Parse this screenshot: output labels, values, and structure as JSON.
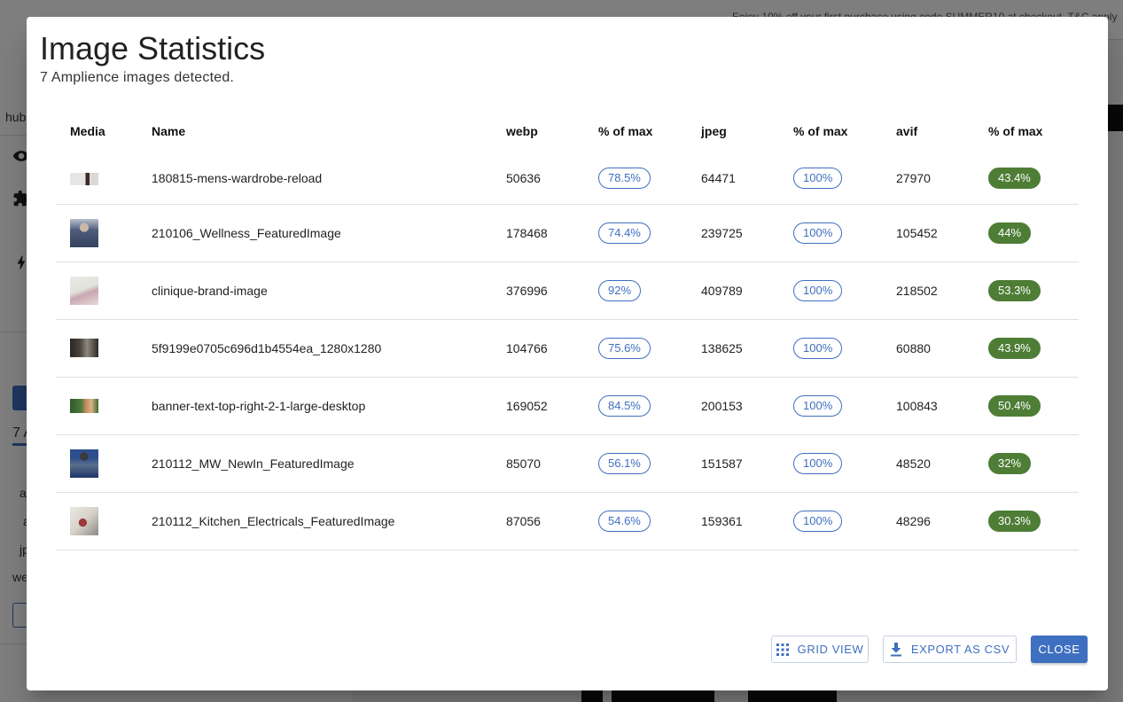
{
  "background": {
    "promo_text": "Enjoy 10% off your first purchase using code SUMMER10 at checkout. T&C apply",
    "sidebar_text": [
      "hub",
      "7 A",
      "au",
      "a",
      "jp",
      "we"
    ]
  },
  "dialog": {
    "title": "Image Statistics",
    "subtitle": "7 Amplience images detected.",
    "columns": [
      "Media",
      "Name",
      "webp",
      "% of max",
      "jpeg",
      "% of max",
      "avif",
      "% of max"
    ],
    "rows": [
      {
        "name": "180815-mens-wardrobe-reload",
        "webp": "50636",
        "webp_pct": "78.5%",
        "jpeg": "64471",
        "jpeg_pct": "100%",
        "avif": "27970",
        "avif_pct": "43.4%"
      },
      {
        "name": "210106_Wellness_FeaturedImage",
        "webp": "178468",
        "webp_pct": "74.4%",
        "jpeg": "239725",
        "jpeg_pct": "100%",
        "avif": "105452",
        "avif_pct": "44%"
      },
      {
        "name": "clinique-brand-image",
        "webp": "376996",
        "webp_pct": "92%",
        "jpeg": "409789",
        "jpeg_pct": "100%",
        "avif": "218502",
        "avif_pct": "53.3%"
      },
      {
        "name": "5f9199e0705c696d1b4554ea_1280x1280",
        "webp": "104766",
        "webp_pct": "75.6%",
        "jpeg": "138625",
        "jpeg_pct": "100%",
        "avif": "60880",
        "avif_pct": "43.9%"
      },
      {
        "name": "banner-text-top-right-2-1-large-desktop",
        "webp": "169052",
        "webp_pct": "84.5%",
        "jpeg": "200153",
        "jpeg_pct": "100%",
        "avif": "100843",
        "avif_pct": "50.4%"
      },
      {
        "name": "210112_MW_NewIn_FeaturedImage",
        "webp": "85070",
        "webp_pct": "56.1%",
        "jpeg": "151587",
        "jpeg_pct": "100%",
        "avif": "48520",
        "avif_pct": "32%"
      },
      {
        "name": "210112_Kitchen_Electricals_FeaturedImage",
        "webp": "87056",
        "webp_pct": "54.6%",
        "jpeg": "159361",
        "jpeg_pct": "100%",
        "avif": "48296",
        "avif_pct": "30.3%"
      }
    ],
    "buttons": {
      "grid_view": "Grid View",
      "export_csv": "Export as CSV",
      "close": "Close"
    }
  },
  "icons": {
    "grid_view": "grid-icon",
    "export_csv": "download-icon"
  },
  "colors": {
    "primary": "#3f6fc0",
    "chip_filled": "#4e7d36",
    "overlay": "rgba(0,0,0,0.5)"
  }
}
